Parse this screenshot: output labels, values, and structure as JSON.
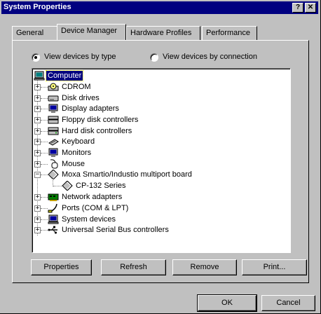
{
  "window": {
    "title": "System Properties",
    "help_glyph": "?",
    "close_glyph": "✕"
  },
  "tabs": [
    {
      "label": "General",
      "active": false
    },
    {
      "label": "Device Manager",
      "active": true
    },
    {
      "label": "Hardware Profiles",
      "active": false
    },
    {
      "label": "Performance",
      "active": false
    }
  ],
  "view_options": {
    "by_type": {
      "label": "View devices by type",
      "selected": true
    },
    "by_connection": {
      "label": "View devices by connection",
      "selected": false
    }
  },
  "tree": {
    "root": {
      "label": "Computer",
      "icon": "computer-icon",
      "selected": true
    },
    "items": [
      {
        "label": "CDROM",
        "icon": "cdrom-icon",
        "expander": "+"
      },
      {
        "label": "Disk drives",
        "icon": "disk-drive-icon",
        "expander": "+"
      },
      {
        "label": "Display adapters",
        "icon": "monitor-icon",
        "expander": "+"
      },
      {
        "label": "Floppy disk controllers",
        "icon": "floppy-controller-icon",
        "expander": "+"
      },
      {
        "label": "Hard disk controllers",
        "icon": "hard-disk-controller-icon",
        "expander": "+"
      },
      {
        "label": "Keyboard",
        "icon": "keyboard-icon",
        "expander": "+"
      },
      {
        "label": "Monitors",
        "icon": "monitor-icon",
        "expander": "+"
      },
      {
        "label": "Mouse",
        "icon": "mouse-icon",
        "expander": "+"
      },
      {
        "label": "Moxa Smartio/Industio multiport board",
        "icon": "multiport-board-icon",
        "expander": "−"
      },
      {
        "label": "CP-132 Series",
        "icon": "multiport-board-icon",
        "child": true
      },
      {
        "label": "Network adapters",
        "icon": "network-adapter-icon",
        "expander": "+"
      },
      {
        "label": "Ports (COM & LPT)",
        "icon": "port-icon",
        "expander": "+"
      },
      {
        "label": "System devices",
        "icon": "system-device-icon",
        "expander": "+"
      },
      {
        "label": "Universal Serial Bus controllers",
        "icon": "usb-icon",
        "expander": "+"
      }
    ]
  },
  "buttons": {
    "properties": "Properties",
    "refresh": "Refresh",
    "remove": "Remove",
    "print": "Print...",
    "ok": "OK",
    "cancel": "Cancel"
  }
}
